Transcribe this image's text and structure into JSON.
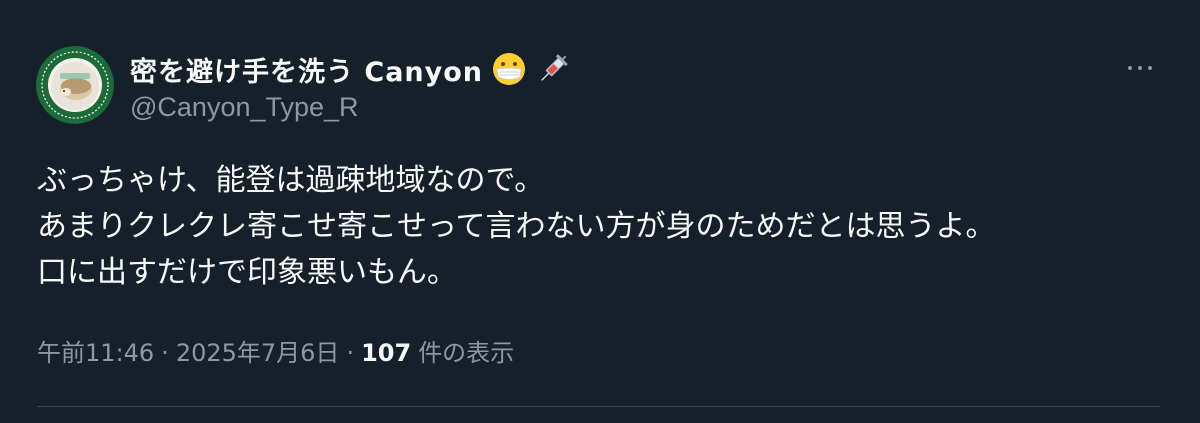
{
  "author": {
    "display_name": "密を避け手を洗う Canyon",
    "emoji_icons": [
      "face-with-medical-mask-icon",
      "syringe-icon"
    ],
    "handle": "@Canyon_Type_R",
    "avatar_ring_text": "I GOT VACCINATED I GOT I GOT"
  },
  "tweet": {
    "lines": [
      "ぶっちゃけ、能登は過疎地域なので。",
      "あまりクレクレ寄こせ寄こせって言わない方が身のためだとは思うよ。",
      "口に出すだけで印象悪いもん。"
    ]
  },
  "meta": {
    "time": "午前11:46",
    "separator": "·",
    "date": "2025年7月6日",
    "views_count": "107",
    "views_label": "件の表示"
  },
  "colors": {
    "background": "#15202b",
    "text": "#f7f9f9",
    "secondary": "#8b98a5",
    "divider": "#38444d"
  }
}
